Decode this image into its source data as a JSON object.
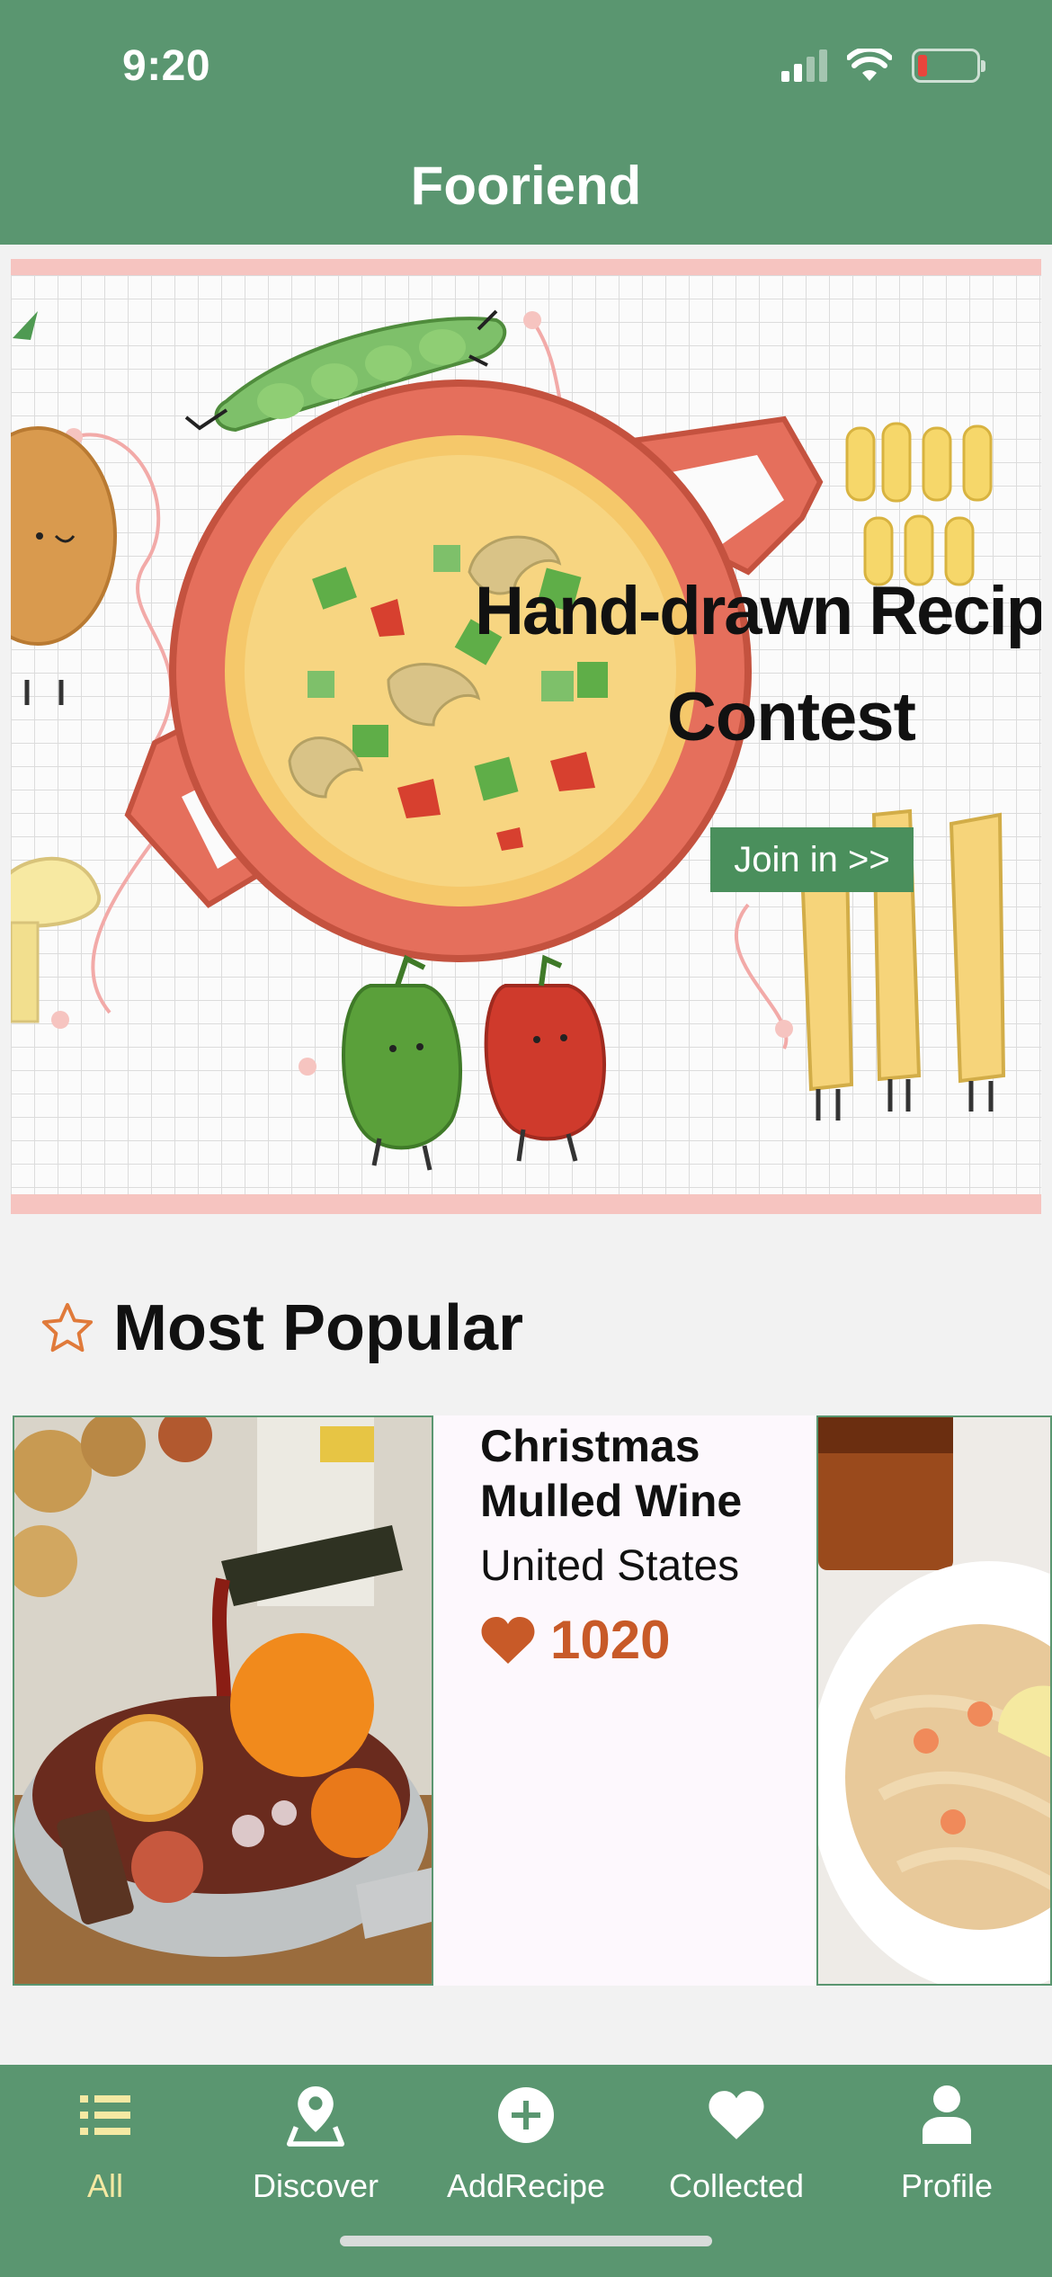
{
  "status_bar": {
    "time": "9:20"
  },
  "header": {
    "title": "Fooriend"
  },
  "banner": {
    "title_line1": "Hand-drawn Recipe",
    "title_line2": "Contest",
    "cta_label": "Join in >>"
  },
  "popular": {
    "section_title": "Most Popular",
    "items": [
      {
        "name": "Christmas Mulled Wine",
        "country": "United States",
        "likes": "1020"
      }
    ]
  },
  "tabbar": {
    "items": [
      {
        "label": "All",
        "icon": "list-icon",
        "active": true
      },
      {
        "label": "Discover",
        "icon": "map-pin-icon",
        "active": false
      },
      {
        "label": "AddRecipe",
        "icon": "plus-circle-icon",
        "active": false
      },
      {
        "label": "Collected",
        "icon": "heart-icon",
        "active": false
      },
      {
        "label": "Profile",
        "icon": "person-icon",
        "active": false
      }
    ]
  },
  "colors": {
    "brand_green": "#5a9670",
    "like_orange": "#c85a28",
    "active_tab": "#f5e9a3",
    "banner_border": "#f6c4c0",
    "cta_green": "#4a8f5c"
  }
}
